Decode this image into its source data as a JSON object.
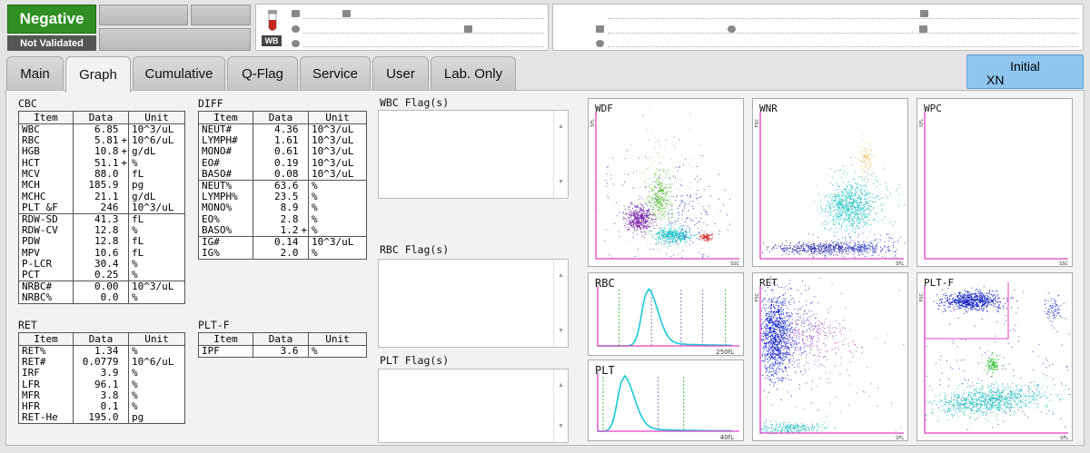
{
  "status": {
    "result": "Negative",
    "validation": "Not Validated"
  },
  "header": {
    "tube_label": "WB"
  },
  "tabs": [
    "Main",
    "Graph",
    "Cumulative",
    "Q-Flag",
    "Service",
    "User",
    "Lab. Only"
  ],
  "active_tab": "Graph",
  "mode": {
    "line1": "Initial",
    "line2": "XN"
  },
  "colors": {
    "negative": "#2f8f22",
    "initial_button": "#8ec6ef",
    "axis": "#e040c0"
  },
  "cbc": {
    "title": "CBC",
    "headers": [
      "Item",
      "Data",
      "Unit"
    ],
    "rows": [
      [
        "WBC",
        "6.85",
        "",
        "10^3/uL"
      ],
      [
        "RBC",
        "5.81",
        "+",
        "10^6/uL"
      ],
      [
        "HGB",
        "10.8",
        "+",
        "g/dL"
      ],
      [
        "HCT",
        "51.1",
        "+",
        "%"
      ],
      [
        "MCV",
        "88.0",
        "",
        "fL"
      ],
      [
        "MCH",
        "185.9",
        "",
        "pg"
      ],
      [
        "MCHC",
        "21.1",
        "",
        "g/dL"
      ],
      [
        "PLT &F",
        "246",
        "",
        "10^3/uL"
      ],
      [
        "RDW-SD",
        "41.3",
        "",
        "fL"
      ],
      [
        "RDW-CV",
        "12.8",
        "",
        "%"
      ],
      [
        "PDW",
        "12.8",
        "",
        "fL"
      ],
      [
        "MPV",
        "10.6",
        "",
        "fL"
      ],
      [
        "P-LCR",
        "30.4",
        "",
        "%"
      ],
      [
        "PCT",
        "0.25",
        "",
        "%"
      ],
      [
        "NRBC#",
        "0.00",
        "",
        "10^3/uL"
      ],
      [
        "NRBC%",
        "0.0",
        "",
        "%"
      ]
    ]
  },
  "diff": {
    "title": "DIFF",
    "headers": [
      "Item",
      "Data",
      "Unit"
    ],
    "rows": [
      [
        "NEUT#",
        "4.36",
        "",
        "10^3/uL"
      ],
      [
        "LYMPH#",
        "1.61",
        "",
        "10^3/uL"
      ],
      [
        "MONO#",
        "0.61",
        "",
        "10^3/uL"
      ],
      [
        "EO#",
        "0.19",
        "",
        "10^3/uL"
      ],
      [
        "BASO#",
        "0.08",
        "",
        "10^3/uL"
      ],
      [
        "NEUT%",
        "63.6",
        "",
        "%"
      ],
      [
        "LYMPH%",
        "23.5",
        "",
        "%"
      ],
      [
        "MONO%",
        "8.9",
        "",
        "%"
      ],
      [
        "EO%",
        "2.8",
        "",
        "%"
      ],
      [
        "BASO%",
        "1.2",
        "+",
        "%"
      ],
      [
        "IG#",
        "0.14",
        "",
        "10^3/uL"
      ],
      [
        "IG%",
        "2.0",
        "",
        "%"
      ]
    ]
  },
  "ret": {
    "title": "RET",
    "headers": [
      "Item",
      "Data",
      "Unit"
    ],
    "rows": [
      [
        "RET%",
        "1.34",
        "",
        "%"
      ],
      [
        "RET#",
        "0.0779",
        "",
        "10^6/uL"
      ],
      [
        "IRF",
        "3.9",
        "",
        "%"
      ],
      [
        "LFR",
        "96.1",
        "",
        "%"
      ],
      [
        "MFR",
        "3.8",
        "",
        "%"
      ],
      [
        "HFR",
        "0.1",
        "",
        "%"
      ],
      [
        "RET-He",
        "195.0",
        "",
        "pg"
      ]
    ]
  },
  "pltf": {
    "title": "PLT-F",
    "headers": [
      "Item",
      "Data",
      "Unit"
    ],
    "rows": [
      [
        "IPF",
        "3.6",
        "",
        "%"
      ]
    ]
  },
  "flags": {
    "wbc": "WBC Flag(s)",
    "rbc": "RBC Flag(s)",
    "plt": "PLT Flag(s)"
  },
  "scattergrams": {
    "wdf": {
      "title": "WDF",
      "xlabel": "SSC",
      "ylabel": "SFL"
    },
    "wnr": {
      "title": "WNR",
      "xlabel": "SFL",
      "ylabel": "FSC"
    },
    "wpc": {
      "title": "WPC",
      "xlabel": "SSC",
      "ylabel": "SFL"
    },
    "ret": {
      "title": "RET",
      "xlabel": "SFL",
      "ylabel": "FSC"
    },
    "pltf": {
      "title": "PLT-F",
      "xlabel": "SFL",
      "ylabel": "FSC"
    }
  },
  "histograms": {
    "rbc": {
      "title": "RBC",
      "scale": "250fL"
    },
    "plt": {
      "title": "PLT",
      "scale": "40fL"
    }
  }
}
